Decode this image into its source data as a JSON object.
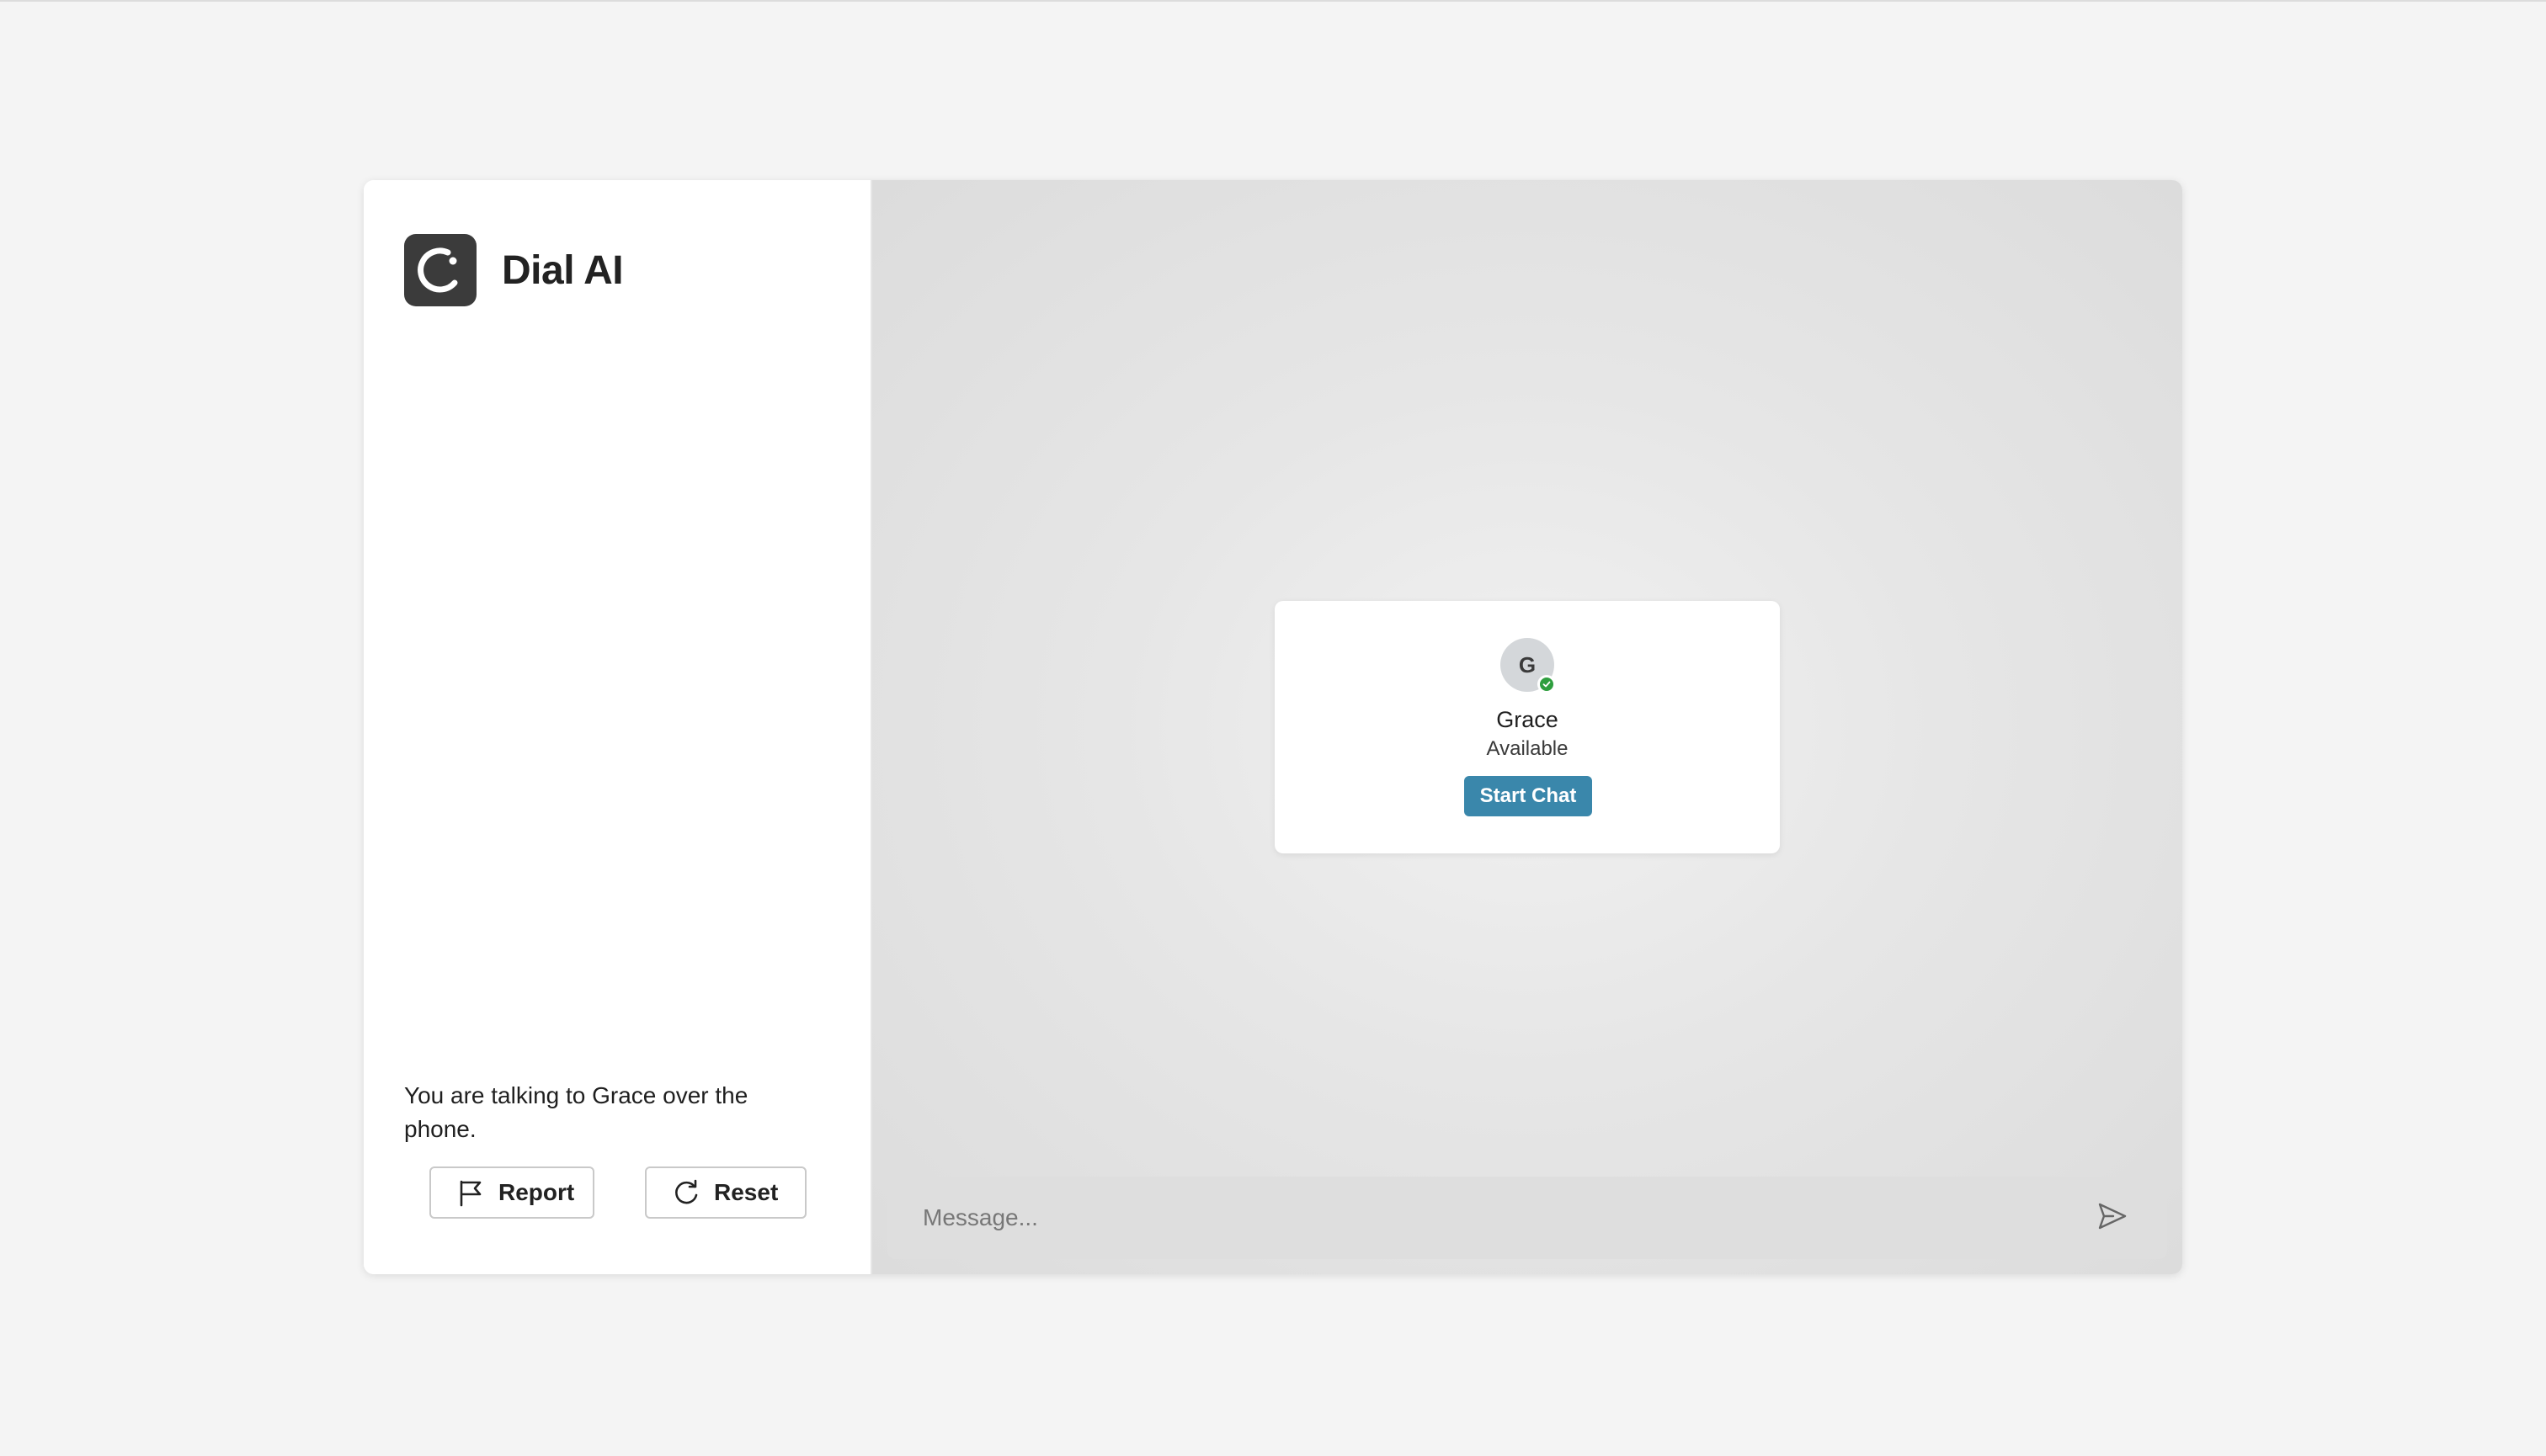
{
  "brand": {
    "name": "Dial AI",
    "logo_icon": "dial-ai-logo-icon"
  },
  "sidebar": {
    "status_text": "You are talking to Grace over the phone.",
    "report_label": "Report",
    "reset_label": "Reset",
    "report_icon": "flag-icon",
    "reset_icon": "refresh-icon"
  },
  "contact": {
    "initial": "G",
    "name": "Grace",
    "status": "Available",
    "start_chat_label": "Start Chat",
    "online_color": "#2e9e3e"
  },
  "composer": {
    "placeholder": "Message...",
    "send_icon": "send-icon"
  },
  "colors": {
    "accent": "#3a87ab",
    "logo_bg": "#3b3b3b"
  }
}
